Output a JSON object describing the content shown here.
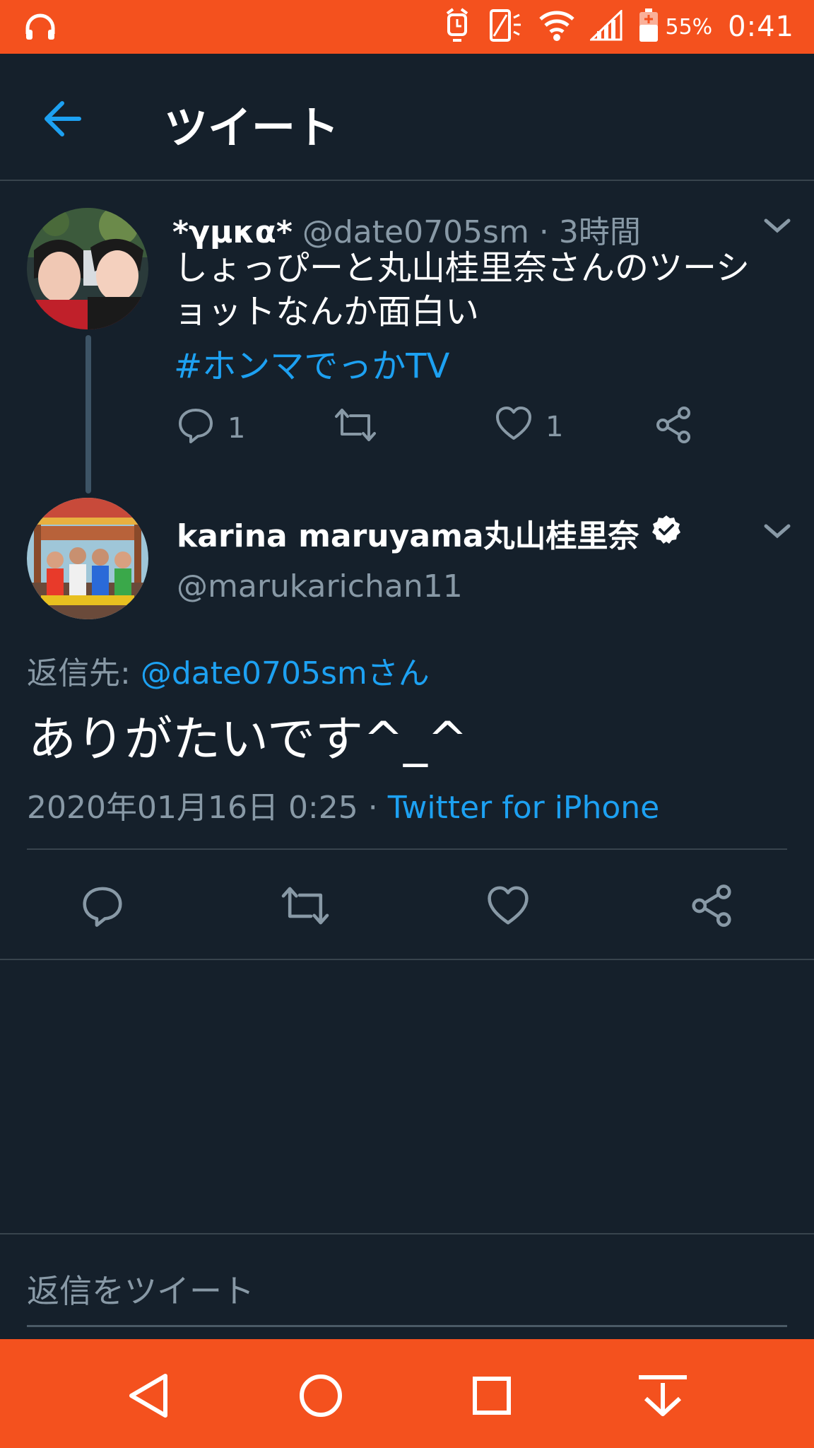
{
  "status_bar": {
    "battery_percent": "55%",
    "time": "0:41",
    "icons": [
      "headphones-icon",
      "alarm-icon",
      "vibrate-icon",
      "wifi-icon",
      "signal-icon",
      "battery-icon"
    ]
  },
  "header": {
    "title": "ツイート"
  },
  "parent_tweet": {
    "display_name": "*γμκα*",
    "handle": "@date0705sm",
    "separator": "·",
    "time_ago": "3時間",
    "text": "しょっぴーと丸山桂里奈さんのツーショットなんか面白い",
    "hashtag": "#ホンマでっかTV",
    "reply_count": "1",
    "like_count": "1"
  },
  "main_tweet": {
    "display_name": "karina maruyama丸山桂里奈",
    "verified": true,
    "handle": "@marukarichan11",
    "replying_label": "返信先: ",
    "replying_to": "@date0705smさん",
    "text": "ありがたいです^_^",
    "timestamp": "2020年01月16日 0:25",
    "separator": "·",
    "source": "Twitter for iPhone"
  },
  "reply_bar": {
    "placeholder": "返信をツイート"
  },
  "colors": {
    "background": "#15202b",
    "accent": "#1da1f2",
    "system_bar": "#f4511e",
    "muted_text": "#8899a6",
    "divider": "#38444d"
  }
}
